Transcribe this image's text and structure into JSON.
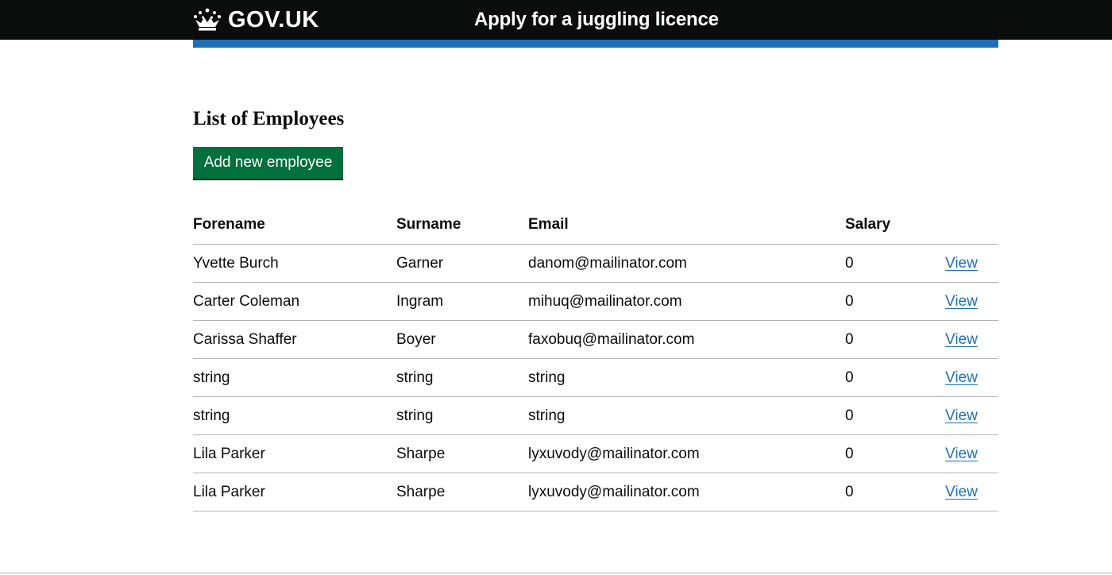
{
  "header": {
    "logo_text": "GOV.UK",
    "service_name": "Apply for a juggling licence"
  },
  "colors": {
    "header_bg": "#0b0c0c",
    "accent_bar": "#1d70b8",
    "button_green": "#00703c",
    "link_blue": "#1d70b8"
  },
  "main": {
    "title": "List of Employees",
    "add_button_label": "Add new employee",
    "table": {
      "headers": [
        "Forename",
        "Surname",
        "Email",
        "Salary",
        ""
      ],
      "rows": [
        {
          "forename": "Yvette Burch",
          "surname": "Garner",
          "email": "danom@mailinator.com",
          "salary": "0",
          "action": "View"
        },
        {
          "forename": "Carter Coleman",
          "surname": "Ingram",
          "email": "mihuq@mailinator.com",
          "salary": "0",
          "action": "View"
        },
        {
          "forename": "Carissa Shaffer",
          "surname": "Boyer",
          "email": "faxobuq@mailinator.com",
          "salary": "0",
          "action": "View"
        },
        {
          "forename": "string",
          "surname": "string",
          "email": "string",
          "salary": "0",
          "action": "View"
        },
        {
          "forename": "string",
          "surname": "string",
          "email": "string",
          "salary": "0",
          "action": "View"
        },
        {
          "forename": "Lila Parker",
          "surname": "Sharpe",
          "email": "lyxuvody@mailinator.com",
          "salary": "0",
          "action": "View"
        },
        {
          "forename": "Lila Parker",
          "surname": "Sharpe",
          "email": "lyxuvody@mailinator.com",
          "salary": "0",
          "action": "View"
        }
      ]
    }
  }
}
